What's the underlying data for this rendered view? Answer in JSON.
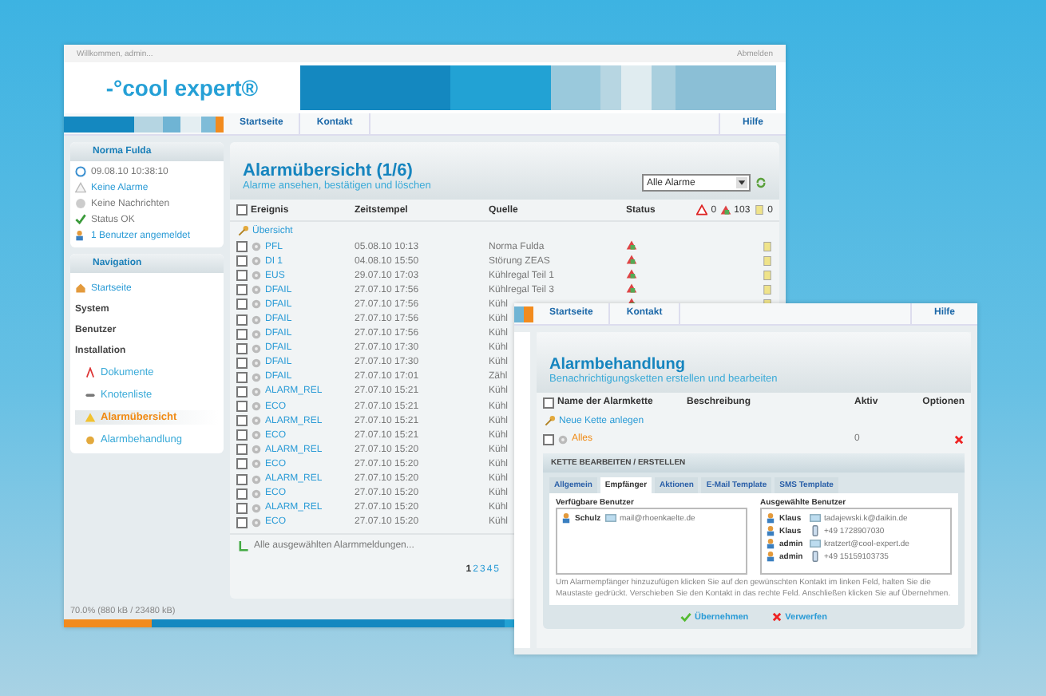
{
  "top_bar": {
    "greeting": "Willkommen, admin...",
    "logout": "Abmelden"
  },
  "logo": "-°cool expert®",
  "nav": {
    "items": [
      "Startseite",
      "Kontakt"
    ],
    "help": "Hilfe"
  },
  "sidebar": {
    "header": "Norma Fulda",
    "status": [
      {
        "text": "09.08.10 10:38:10",
        "kind": "plain"
      },
      {
        "text": "Keine Alarme",
        "kind": "link"
      },
      {
        "text": "Keine Nachrichten",
        "kind": "plain"
      },
      {
        "text": "Status OK",
        "kind": "plain"
      },
      {
        "text": "1 Benutzer angemeldet",
        "kind": "link"
      }
    ],
    "nav_header": "Navigation",
    "nav": [
      {
        "label": "Startseite",
        "kind": "link",
        "selected": false
      },
      {
        "label": "System",
        "kind": "section",
        "selected": false
      },
      {
        "label": "Benutzer",
        "kind": "section",
        "selected": false
      },
      {
        "label": "Installation",
        "kind": "section",
        "selected": false
      },
      {
        "label": "Dokumente",
        "kind": "sub",
        "selected": false
      },
      {
        "label": "Knotenliste",
        "kind": "sub",
        "selected": false
      },
      {
        "label": "Alarmübersicht",
        "kind": "sub",
        "selected": true
      },
      {
        "label": "Alarmbehandlung",
        "kind": "sub",
        "selected": false
      }
    ]
  },
  "main": {
    "title": "Alarmübersicht (1/6)",
    "subtitle": "Alarme ansehen, bestätigen und löschen",
    "filter": "Alle Alarme",
    "columns": [
      "Ereignis",
      "Zeitstempel",
      "Quelle",
      "Status"
    ],
    "select_all_checked": false,
    "counts": [
      "0",
      "103",
      "0"
    ],
    "overview": "Übersicht",
    "rows": [
      {
        "event": "PFL",
        "time": "05.08.10 10:13",
        "source": "Norma Fulda",
        "checked": false
      },
      {
        "event": "DI 1",
        "time": "04.08.10 15:50",
        "source": "Störung ZEAS",
        "checked": false
      },
      {
        "event": "EUS",
        "time": "29.07.10 17:03",
        "source": "Kühlregal Teil 1",
        "checked": false
      },
      {
        "event": "DFAIL",
        "time": "27.07.10 17:56",
        "source": "Kühlregal Teil 3",
        "checked": false
      },
      {
        "event": "DFAIL",
        "time": "27.07.10 17:56",
        "source": "Kühl",
        "checked": false
      },
      {
        "event": "DFAIL",
        "time": "27.07.10 17:56",
        "source": "Kühl",
        "checked": false
      },
      {
        "event": "DFAIL",
        "time": "27.07.10 17:56",
        "source": "Kühl",
        "checked": false
      },
      {
        "event": "DFAIL",
        "time": "27.07.10 17:30",
        "source": "Kühl",
        "checked": false
      },
      {
        "event": "DFAIL",
        "time": "27.07.10 17:30",
        "source": "Kühl",
        "checked": false
      },
      {
        "event": "DFAIL",
        "time": "27.07.10 17:01",
        "source": "Zähl",
        "checked": false
      },
      {
        "event": "ALARM_REL",
        "time": "27.07.10 15:21",
        "source": "Kühl",
        "checked": false
      },
      {
        "event": "ECO",
        "time": "27.07.10 15:21",
        "source": "Kühl",
        "checked": false
      },
      {
        "event": "ALARM_REL",
        "time": "27.07.10 15:21",
        "source": "Kühl",
        "checked": false
      },
      {
        "event": "ECO",
        "time": "27.07.10 15:21",
        "source": "Kühl",
        "checked": false
      },
      {
        "event": "ALARM_REL",
        "time": "27.07.10 15:20",
        "source": "Kühl",
        "checked": false
      },
      {
        "event": "ECO",
        "time": "27.07.10 15:20",
        "source": "Kühl",
        "checked": false
      },
      {
        "event": "ALARM_REL",
        "time": "27.07.10 15:20",
        "source": "Kühl",
        "checked": false
      },
      {
        "event": "ECO",
        "time": "27.07.10 15:20",
        "source": "Kühl",
        "checked": false
      },
      {
        "event": "ALARM_REL",
        "time": "27.07.10 15:20",
        "source": "Kühl",
        "checked": false
      },
      {
        "event": "ECO",
        "time": "27.07.10 15:20",
        "source": "Kühl",
        "checked": false
      }
    ],
    "footer_link": "Alle ausgewählten Alarmmeldungen...",
    "pages": [
      {
        "label": "1",
        "selected": true
      },
      {
        "label": "2",
        "selected": false
      },
      {
        "label": "3",
        "selected": false
      },
      {
        "label": "4",
        "selected": false
      },
      {
        "label": "5",
        "selected": false
      }
    ]
  },
  "status_bar": {
    "text": "70.0% (880 kB / 23480 kB)"
  },
  "window2": {
    "nav": [
      "Startseite",
      "Kontakt"
    ],
    "help": "Hilfe",
    "title": "Alarmbehandlung",
    "subtitle": "Benachrichtigungsketten erstellen und bearbeiten",
    "columns": [
      "Name der Alarmkette",
      "Beschreibung",
      "Aktiv",
      "Optionen"
    ],
    "select_all_checked": false,
    "new_link": "Neue Kette anlegen",
    "chains": [
      {
        "name": "Alles",
        "active": "0",
        "checked": false
      }
    ],
    "panel_title": "KETTE BEARBEITEN / ERSTELLEN",
    "tabs": [
      {
        "label": "Allgemein",
        "selected": false
      },
      {
        "label": "Empfänger",
        "selected": true
      },
      {
        "label": "Aktionen",
        "selected": false
      },
      {
        "label": "E-Mail Template",
        "selected": false
      },
      {
        "label": "SMS Template",
        "selected": false
      }
    ],
    "available": {
      "label": "Verfügbare Benutzer",
      "users": [
        {
          "name": "Schulz",
          "contact": "mail@rhoenkaelte.de",
          "kind": "email"
        }
      ]
    },
    "chosen": {
      "label": "Ausgewählte Benutzer",
      "users": [
        {
          "name": "Klaus",
          "contact": "tadajewski.k@daikin.de",
          "kind": "email"
        },
        {
          "name": "Klaus",
          "contact": "+49 1728907030",
          "kind": "phone"
        },
        {
          "name": "admin",
          "contact": "kratzert@cool-expert.de",
          "kind": "email"
        },
        {
          "name": "admin",
          "contact": "+49 15159103735",
          "kind": "phone"
        }
      ]
    },
    "hint": "Um Alarmempfänger hinzuzufügen klicken Sie auf den gewünschten Kontakt im linken Feld, halten Sie die Maustaste gedrückt. Verschieben Sie den Kontakt in das rechte Feld. Anschließen klicken Sie auf Übernehmen.",
    "buttons": [
      {
        "label": "Übernehmen",
        "kind": "ok"
      },
      {
        "label": "Verwerfen",
        "kind": "cancel"
      }
    ]
  }
}
